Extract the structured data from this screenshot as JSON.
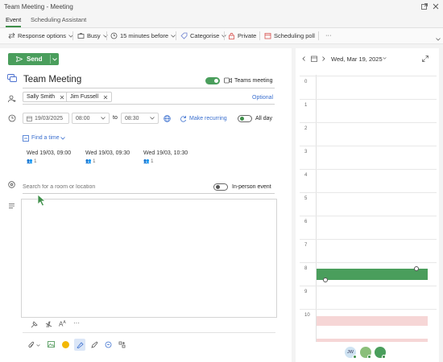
{
  "window": {
    "title": "Team Meeting - Meeting"
  },
  "tabs": [
    {
      "label": "Event"
    },
    {
      "label": "Scheduling Assistant"
    }
  ],
  "toolbar": {
    "response": "Response options",
    "busy": "Busy",
    "reminder": "15 minutes before",
    "categorise": "Categorise",
    "private": "Private",
    "poll": "Scheduling poll",
    "more": "···"
  },
  "form": {
    "send_label": "Send",
    "title": "Team Meeting",
    "teams_label": "Teams meeting",
    "attendees": [
      "Sally Smith",
      "Jim Fussell"
    ],
    "optional_label": "Optional",
    "start_date": "19/03/2025",
    "start_time": "08:00",
    "to_label": "to",
    "end_time": "08:30",
    "recurring_label": "Make recurring",
    "allday_label": "All day",
    "find_time": "Find a time",
    "suggestions": [
      {
        "time": "Wed 19/03, 09:00",
        "count": "1"
      },
      {
        "time": "Wed 19/03, 09:30",
        "count": "1"
      },
      {
        "time": "Wed 19/03, 10:30",
        "count": "1"
      }
    ],
    "location_placeholder": "Search for a room or location",
    "inperson_label": "In-person event"
  },
  "calendar": {
    "date_label": "Wed, Mar 19, 2025",
    "hours": [
      "0",
      "1",
      "2",
      "3",
      "4",
      "5",
      "6",
      "7",
      "8",
      "9",
      "10"
    ],
    "avatar_initials": "JW"
  },
  "colors": {
    "accent": "#4a9e5c",
    "busy_block": "#f6d6d6"
  }
}
